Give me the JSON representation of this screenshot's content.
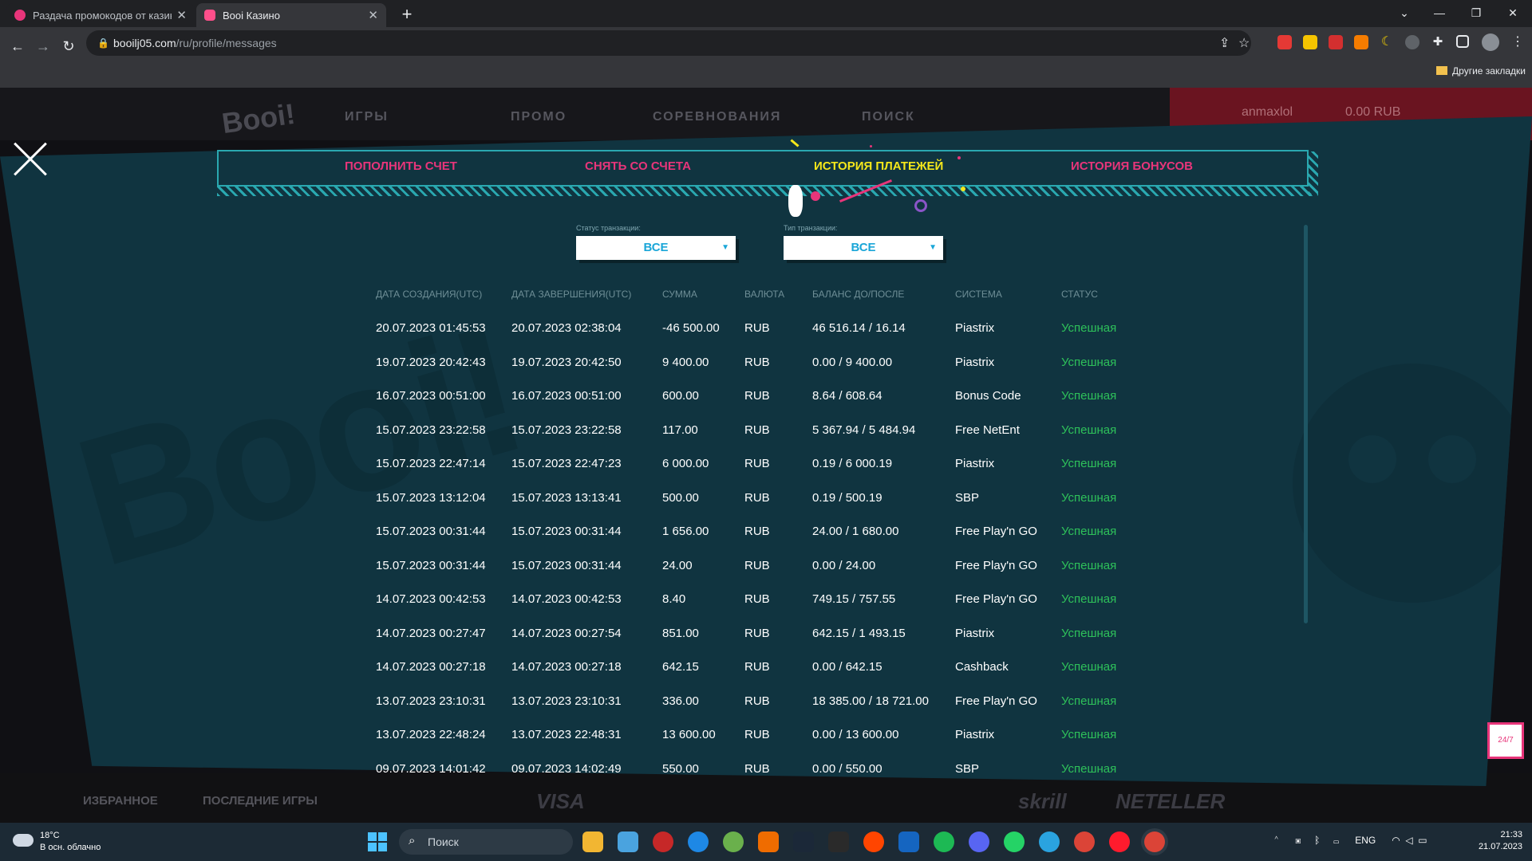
{
  "browser": {
    "tabs": [
      {
        "title": "Раздача промокодов от казино",
        "favicon_color": "#e8357a"
      },
      {
        "title": "Booi Казино",
        "favicon_color": "#e8357a"
      }
    ],
    "new_tab": "+",
    "url_host": "booilj05.com",
    "url_path": "/ru/profile/messages",
    "bookmarks_label": "Другие закладки"
  },
  "site": {
    "logo": "Booi!",
    "nav": [
      "ИГРЫ",
      "ПРОМО",
      "СОРЕВНОВАНИЯ",
      "ПОИСК"
    ],
    "username": "anmaxlol",
    "balance": "0.00 RUB",
    "bottom_tabs": [
      "ИЗБРАННОЕ",
      "ПОСЛЕДНИЕ ИГРЫ"
    ],
    "payment_logos": [
      "VISA",
      "skrill",
      "NETELLER"
    ]
  },
  "modal": {
    "tabs": [
      {
        "label": "ПОПОЛНИТЬ СЧЕТ",
        "active": false
      },
      {
        "label": "СНЯТЬ СО СЧЕТА",
        "active": false
      },
      {
        "label": "ИСТОРИЯ ПЛАТЕЖЕЙ",
        "active": true
      },
      {
        "label": "ИСТОРИЯ БОНУСОВ",
        "active": false
      }
    ],
    "filters": {
      "status_label": "Статус транзакции:",
      "status_value": "ВСЕ",
      "type_label": "Тип транзакции:",
      "type_value": "ВСЕ"
    },
    "table": {
      "headers": [
        "ДАТА СОЗДАНИЯ(UTC)",
        "ДАТА ЗАВЕРШЕНИЯ(UTC)",
        "СУММА",
        "ВАЛЮТА",
        "БАЛАНС ДО/ПОСЛЕ",
        "СИСТЕМА",
        "СТАТУС"
      ],
      "rows": [
        [
          "20.07.2023 01:45:53",
          "20.07.2023 02:38:04",
          "-46 500.00",
          "RUB",
          "46 516.14 / 16.14",
          "Piastrix",
          "Успешная"
        ],
        [
          "19.07.2023 20:42:43",
          "19.07.2023 20:42:50",
          "9 400.00",
          "RUB",
          "0.00 / 9 400.00",
          "Piastrix",
          "Успешная"
        ],
        [
          "16.07.2023 00:51:00",
          "16.07.2023 00:51:00",
          "600.00",
          "RUB",
          "8.64 / 608.64",
          "Bonus Code",
          "Успешная"
        ],
        [
          "15.07.2023 23:22:58",
          "15.07.2023 23:22:58",
          "117.00",
          "RUB",
          "5 367.94 / 5 484.94",
          "Free NetEnt",
          "Успешная"
        ],
        [
          "15.07.2023 22:47:14",
          "15.07.2023 22:47:23",
          "6 000.00",
          "RUB",
          "0.19 / 6 000.19",
          "Piastrix",
          "Успешная"
        ],
        [
          "15.07.2023 13:12:04",
          "15.07.2023 13:13:41",
          "500.00",
          "RUB",
          "0.19 / 500.19",
          "SBP",
          "Успешная"
        ],
        [
          "15.07.2023 00:31:44",
          "15.07.2023 00:31:44",
          "1 656.00",
          "RUB",
          "24.00 / 1 680.00",
          "Free Play'n GO",
          "Успешная"
        ],
        [
          "15.07.2023 00:31:44",
          "15.07.2023 00:31:44",
          "24.00",
          "RUB",
          "0.00 / 24.00",
          "Free Play'n GO",
          "Успешная"
        ],
        [
          "14.07.2023 00:42:53",
          "14.07.2023 00:42:53",
          "8.40",
          "RUB",
          "749.15 / 757.55",
          "Free Play'n GO",
          "Успешная"
        ],
        [
          "14.07.2023 00:27:47",
          "14.07.2023 00:27:54",
          "851.00",
          "RUB",
          "642.15 / 1 493.15",
          "Piastrix",
          "Успешная"
        ],
        [
          "14.07.2023 00:27:18",
          "14.07.2023 00:27:18",
          "642.15",
          "RUB",
          "0.00 / 642.15",
          "Cashback",
          "Успешная"
        ],
        [
          "13.07.2023 23:10:31",
          "13.07.2023 23:10:31",
          "336.00",
          "RUB",
          "18 385.00 / 18 721.00",
          "Free Play'n GO",
          "Успешная"
        ],
        [
          "13.07.2023 22:48:24",
          "13.07.2023 22:48:31",
          "13 600.00",
          "RUB",
          "0.00 / 13 600.00",
          "Piastrix",
          "Успешная"
        ],
        [
          "09.07.2023 14:01:42",
          "09.07.2023 14:02:49",
          "550.00",
          "RUB",
          "0.00 / 550.00",
          "SBP",
          "Успешная"
        ]
      ]
    },
    "chat_label": "24/7"
  },
  "taskbar": {
    "temperature": "18°C",
    "weather": "В осн. облачно",
    "search_placeholder": "Поиск",
    "language": "ENG",
    "time": "21:33",
    "date": "21.07.2023"
  },
  "colors": {
    "accent_pink": "#e8357a",
    "active_tab": "#f5e71a",
    "status_ok": "#2ec15a",
    "modal_bg": "#103440"
  }
}
